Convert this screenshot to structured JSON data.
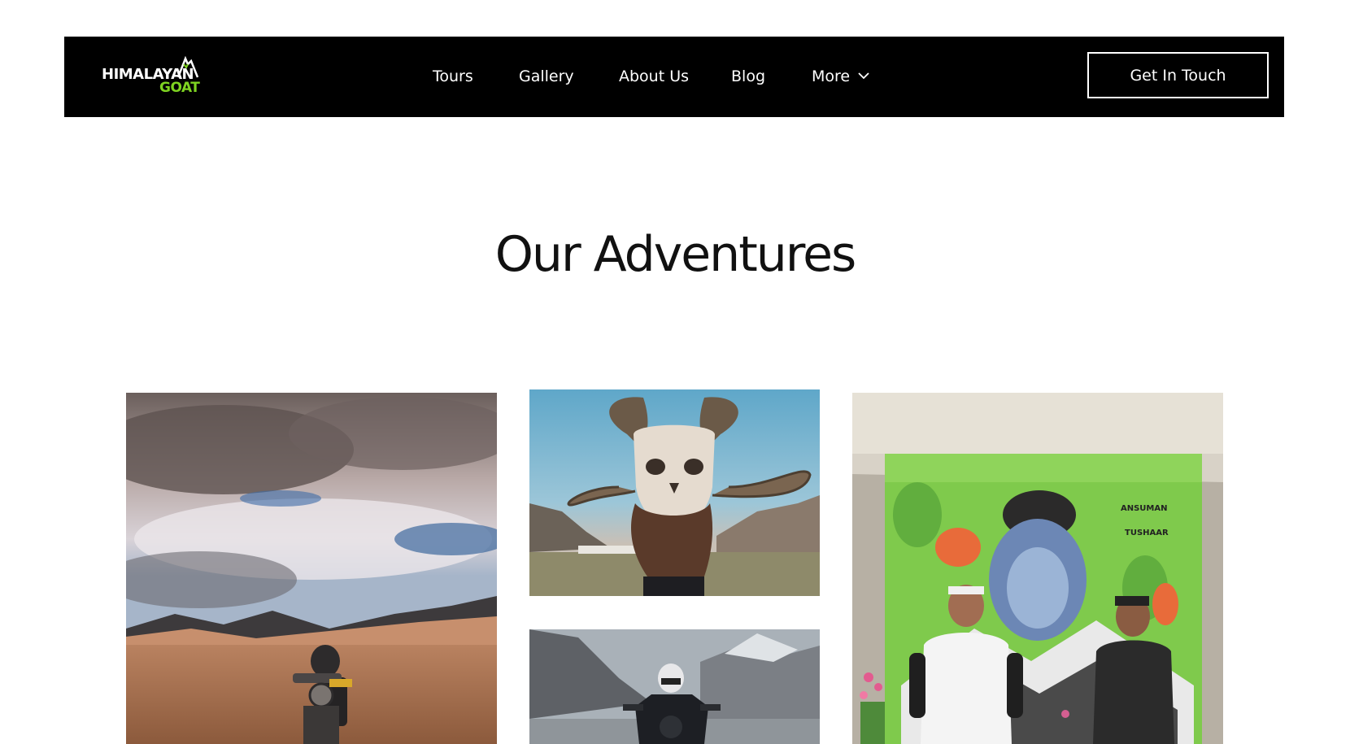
{
  "header": {
    "logo": {
      "line1": "HIMALAYAN",
      "line2": "GOAT",
      "accent_color": "#7ed321"
    },
    "nav": [
      {
        "label": "Tours"
      },
      {
        "label": "Gallery"
      },
      {
        "label": "About Us"
      },
      {
        "label": "Blog"
      },
      {
        "label": "More",
        "icon": "chevron-down-icon"
      }
    ],
    "cta_label": "Get In Touch"
  },
  "main": {
    "title": "Our Adventures"
  },
  "colors": {
    "header_bg": "#000000",
    "page_bg": "#ffffff",
    "title": "#111111"
  }
}
